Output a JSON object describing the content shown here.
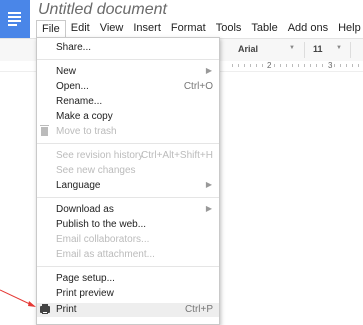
{
  "app": {
    "title": "Untitled document"
  },
  "menubar": [
    "File",
    "Edit",
    "View",
    "Insert",
    "Format",
    "Tools",
    "Table",
    "Add ons",
    "Help"
  ],
  "toolbar": {
    "font": "Arial",
    "size": "11"
  },
  "ruler": {
    "mark1": "2",
    "mark2": "3"
  },
  "file_menu": {
    "share": "Share...",
    "new": "New",
    "open": "Open...",
    "open_shortcut": "Ctrl+O",
    "rename": "Rename...",
    "make_copy": "Make a copy",
    "move_trash": "Move to trash",
    "revision_history": "See revision history",
    "revision_shortcut": "Ctrl+Alt+Shift+H",
    "new_changes": "See new changes",
    "language": "Language",
    "download_as": "Download as",
    "publish": "Publish to the web...",
    "email_collaborators": "Email collaborators...",
    "email_attachment": "Email as attachment...",
    "page_setup": "Page setup...",
    "print_preview": "Print preview",
    "print": "Print",
    "print_shortcut": "Ctrl+P"
  },
  "colors": {
    "accent": "#4a86e8",
    "highlight": "#eeeeee",
    "arrow": "#e53935"
  }
}
